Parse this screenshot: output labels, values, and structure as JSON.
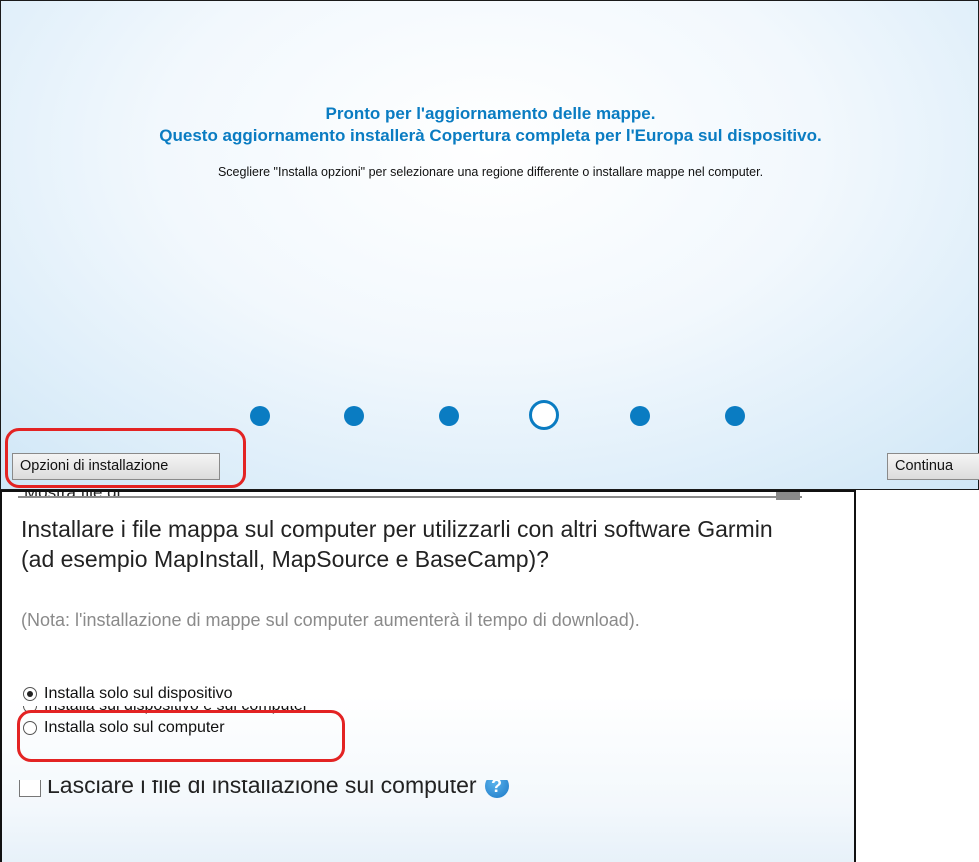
{
  "top": {
    "headline_line1": "Pronto per l'aggiornamento delle mappe.",
    "headline_line2": "Questo aggiornamento installerà Copertura completa per l'Europa sul dispositivo.",
    "instructions": "Scegliere \"Installa opzioni\" per selezionare una regione differente o installare mappe nel computer.",
    "steps_total": 6,
    "current_step": 4,
    "options_button": "Opzioni di installazione",
    "continue_button": "Continua",
    "accent_color": "#0a7cc2",
    "highlight_color": "#e32323"
  },
  "bottom": {
    "cut_off_text": "Mostra file di",
    "question": "Installare i file mappa sul computer per utilizzarli con altri software Garmin (ad esempio MapInstall, MapSource e BaseCamp)?",
    "note": "(Nota: l'installazione di mappe sul computer aumenterà il tempo di download).",
    "radio_options": [
      {
        "label": "Installa solo sul dispositivo",
        "checked": true
      },
      {
        "label": "Installa sul dispositivo e sul computer",
        "checked": false
      },
      {
        "label": "Installa solo sul computer",
        "checked": false
      }
    ],
    "checkbox_label": "Lasciare i file di installazione sul computer",
    "checkbox_checked": false,
    "help_icon": "?"
  }
}
